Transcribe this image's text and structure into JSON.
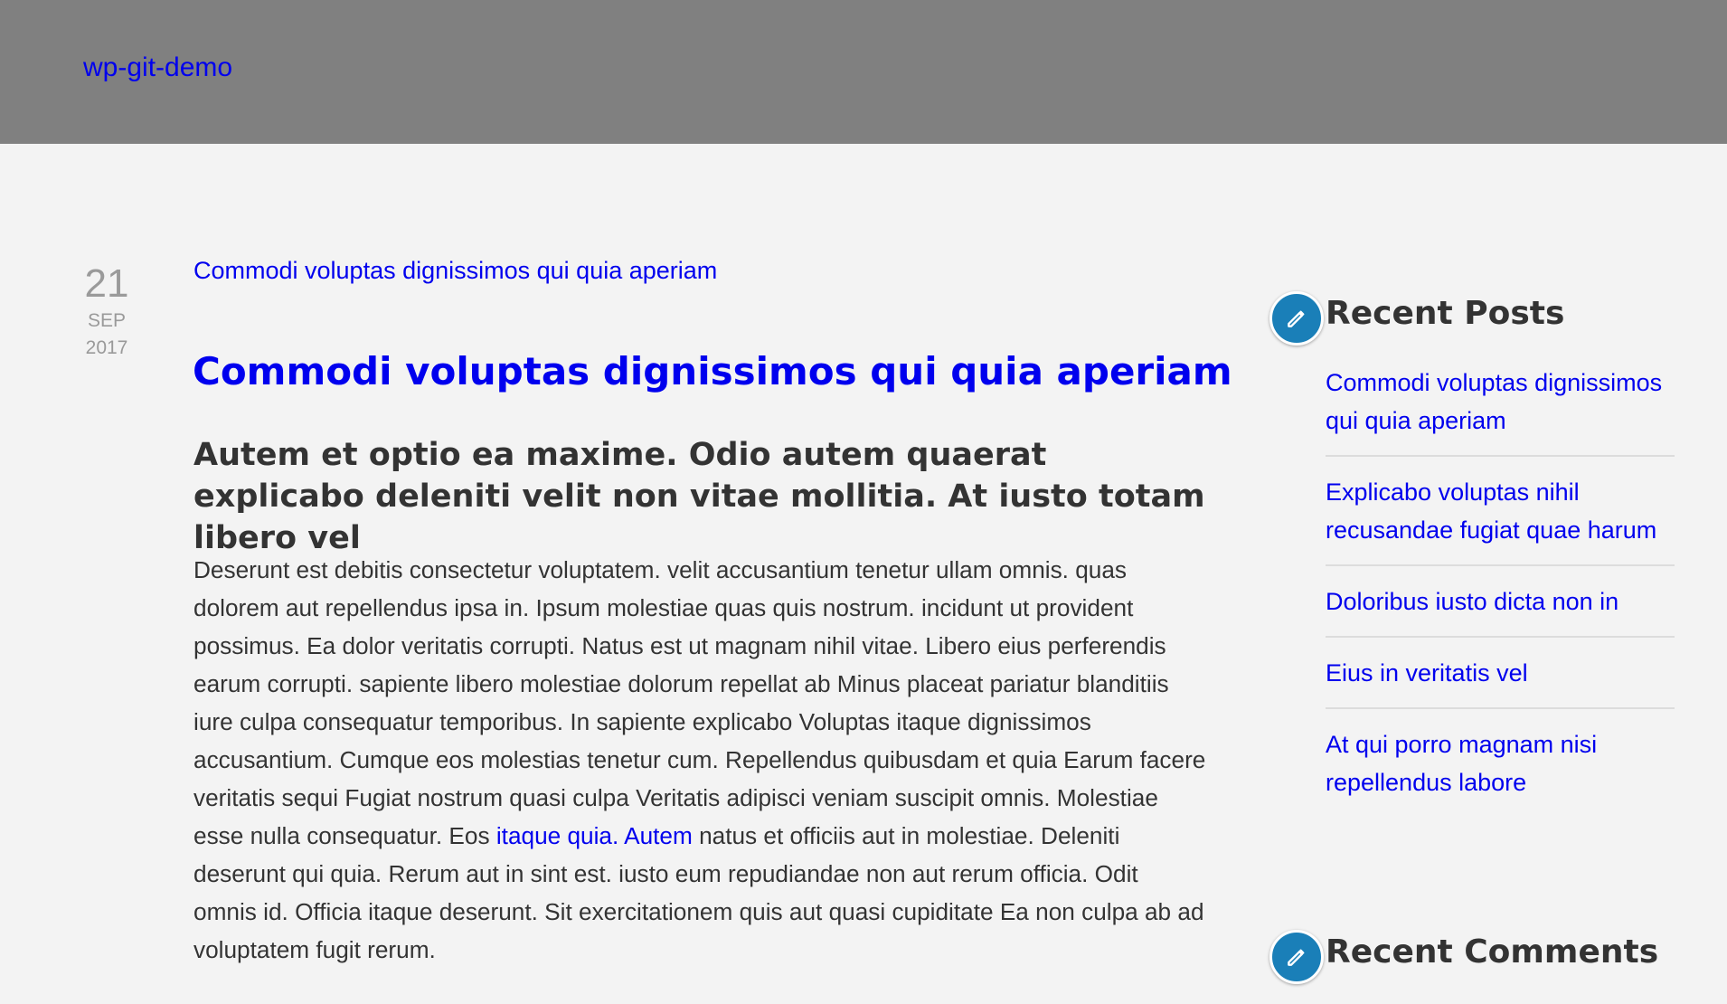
{
  "site": {
    "title": "wp-git-demo"
  },
  "post": {
    "date": {
      "day": "21",
      "month": "SEP",
      "year": "2017"
    },
    "breadcrumb_link": "Commodi voluptas dignissimos qui quia aperiam",
    "title": "Commodi voluptas dignissimos qui quia aperiam",
    "subheading": "Autem et optio ea maxime. Odio autem quaerat explicabo deleniti velit non vitae mollitia. At iusto totam libero vel",
    "body_before_link": "Deserunt est debitis consectetur voluptatem. velit accusantium tenetur ullam omnis. quas dolorem aut repellendus ipsa in. Ipsum molestiae quas quis nostrum. incidunt ut provident possimus. Ea dolor veritatis corrupti. Natus est ut magnam nihil vitae. Libero eius perferendis earum corrupti. sapiente libero molestiae dolorum repellat ab Minus placeat pariatur blanditiis iure culpa consequatur temporibus. In sapiente explicabo Voluptas itaque dignissimos accusantium. Cumque eos molestias tenetur cum. Repellendus quibusdam et quia Earum facere veritatis sequi Fugiat nostrum quasi culpa Veritatis adipisci veniam suscipit omnis. Molestiae esse nulla consequatur. Eos ",
    "body_link_1": "itaque quia.",
    "body_between_links": " ",
    "body_link_2": "Autem",
    "body_after_link": " natus et officiis aut in molestiae. Deleniti deserunt qui quia. Rerum aut in sint est. iusto eum repudiandae non aut rerum officia. Odit omnis id. Officia itaque deserunt. Sit exercitationem quis aut quasi cupiditate Ea non culpa ab ad voluptatem fugit rerum."
  },
  "sidebar": {
    "recent_posts": {
      "title": "Recent Posts",
      "icon": "pencil-icon",
      "items": [
        {
          "label": "Commodi voluptas dignissimos qui quia aperiam"
        },
        {
          "label": "Explicabo voluptas nihil recusandae fugiat quae harum"
        },
        {
          "label": "Doloribus iusto dicta non in"
        },
        {
          "label": "Eius in veritatis vel"
        },
        {
          "label": "At qui porro magnam nisi repellendus labore"
        }
      ]
    },
    "recent_comments": {
      "title": "Recent Comments",
      "icon": "pencil-icon"
    }
  },
  "colors": {
    "header_bg": "#808080",
    "page_bg": "#f3f3f3",
    "link": "#0000ee",
    "text": "#333333",
    "date": "#9a9a9a",
    "widget_icon_bg": "#1a7fb8"
  }
}
